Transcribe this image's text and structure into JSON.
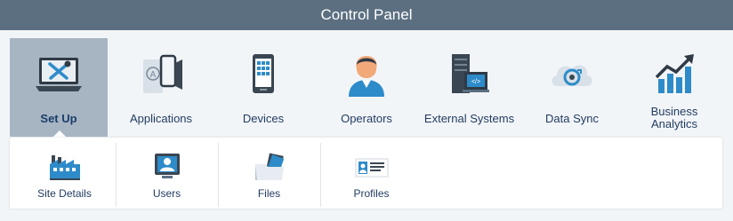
{
  "window": {
    "title": "Control Panel"
  },
  "nav": {
    "items": [
      {
        "label": "Set Up",
        "icon": "tools-laptop-icon",
        "active": true
      },
      {
        "label": "Applications",
        "icon": "apps-devices-icon"
      },
      {
        "label": "Devices",
        "icon": "mobile-device-icon"
      },
      {
        "label": "Operators",
        "icon": "operator-person-icon"
      },
      {
        "label": "External Systems",
        "icon": "server-code-icon"
      },
      {
        "label": "Data Sync",
        "icon": "cloud-sync-icon"
      },
      {
        "label": "Business Analytics",
        "icon": "bar-chart-trend-icon"
      }
    ]
  },
  "submenu": {
    "items": [
      {
        "label": "Site Details",
        "icon": "factory-icon"
      },
      {
        "label": "Users",
        "icon": "user-monitor-icon"
      },
      {
        "label": "Files",
        "icon": "folder-files-icon"
      },
      {
        "label": "Profiles",
        "icon": "profile-card-icon"
      }
    ]
  },
  "colors": {
    "titlebar": "#5b6f81",
    "active_tab": "#a7b5c3",
    "text": "#1f3a5f",
    "accent_blue": "#2e8bc9"
  }
}
